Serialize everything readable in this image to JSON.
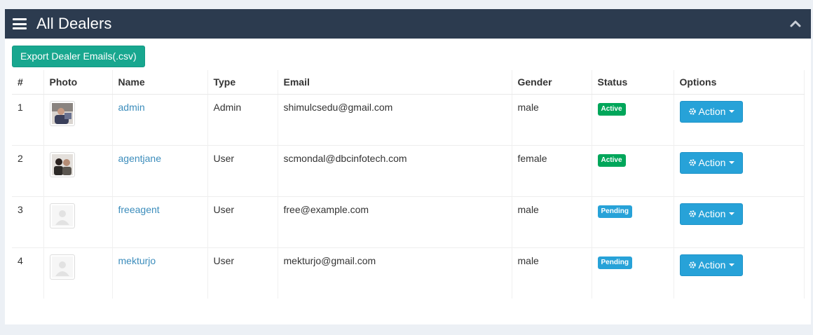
{
  "panel": {
    "title": "All Dealers",
    "menu_icon": "hamburger-icon",
    "collapse_icon": "chevron-up-icon"
  },
  "toolbar": {
    "export_label": "Export Dealer Emails(.csv)",
    "export_color": "#18a78f"
  },
  "table": {
    "headers": [
      "#",
      "Photo",
      "Name",
      "Type",
      "Email",
      "Gender",
      "Status",
      "Options"
    ],
    "rows": [
      {
        "num": "1",
        "photo": "user-photo-admin",
        "name": "admin",
        "type": "Admin",
        "email": "shimulcsedu@gmail.com",
        "gender": "male",
        "status": "Active",
        "action": "Action"
      },
      {
        "num": "2",
        "photo": "user-photo-agentjane",
        "name": "agentjane",
        "type": "User",
        "email": "scmondal@dbcinfotech.com",
        "gender": "female",
        "status": "Active",
        "action": "Action"
      },
      {
        "num": "3",
        "photo": "default-avatar",
        "name": "freeagent",
        "type": "User",
        "email": "free@example.com",
        "gender": "male",
        "status": "Pending",
        "action": "Action"
      },
      {
        "num": "4",
        "photo": "default-avatar",
        "name": "mekturjo",
        "type": "User",
        "email": "mekturjo@gmail.com",
        "gender": "male",
        "status": "Pending",
        "action": "Action"
      }
    ]
  },
  "colors": {
    "header_bg": "#2c3b4f",
    "active": "#00a65a",
    "pending": "#27a2d8",
    "action": "#27a2d8",
    "link": "#3c8dbc"
  }
}
